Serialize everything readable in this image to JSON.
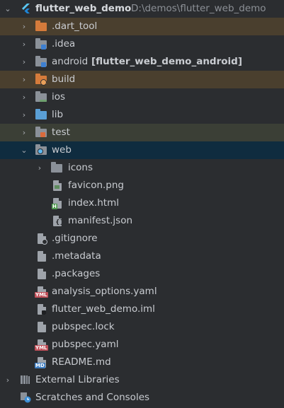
{
  "project": {
    "name": "flutter_web_demo",
    "path": "D:\\demos\\flutter_web_demo"
  },
  "items": [
    {
      "label": ".dart_tool",
      "icon": "folder-excluded-icon"
    },
    {
      "label": ".idea",
      "icon": "folder-icon"
    },
    {
      "label": "android",
      "suffix": "[flutter_web_demo_android]",
      "icon": "folder-module-icon"
    },
    {
      "label": "build",
      "icon": "folder-excluded-icon"
    },
    {
      "label": "ios",
      "icon": "folder-icon"
    },
    {
      "label": "lib",
      "icon": "folder-source-icon"
    },
    {
      "label": "test",
      "icon": "folder-test-icon"
    },
    {
      "label": "web",
      "icon": "folder-web-icon"
    },
    {
      "label": "icons",
      "icon": "folder-icon"
    },
    {
      "label": "favicon.png",
      "icon": "image-file-icon"
    },
    {
      "label": "index.html",
      "icon": "html-file-icon"
    },
    {
      "label": "manifest.json",
      "icon": "json-file-icon"
    },
    {
      "label": ".gitignore",
      "icon": "ignore-file-icon"
    },
    {
      "label": ".metadata",
      "icon": "text-file-icon"
    },
    {
      "label": ".packages",
      "icon": "text-file-icon"
    },
    {
      "label": "analysis_options.yaml",
      "icon": "yaml-file-icon"
    },
    {
      "label": "flutter_web_demo.iml",
      "icon": "iml-file-icon"
    },
    {
      "label": "pubspec.lock",
      "icon": "text-file-icon"
    },
    {
      "label": "pubspec.yaml",
      "icon": "yaml-file-icon"
    },
    {
      "label": "README.md",
      "icon": "markdown-file-icon"
    },
    {
      "label": "External Libraries",
      "icon": "libraries-icon"
    },
    {
      "label": "Scratches and Consoles",
      "icon": "scratches-icon"
    }
  ],
  "badges": {
    "yml": "YML",
    "md": "MD",
    "html": "H"
  },
  "colors": {
    "background": "#2b2d30",
    "selected_row": "#0f2c3f",
    "excluded_row": "#4a3f2e",
    "test_row": "#3b3f36",
    "folder_blue": "#5a9fd6",
    "folder_orange": "#d57b3b"
  }
}
